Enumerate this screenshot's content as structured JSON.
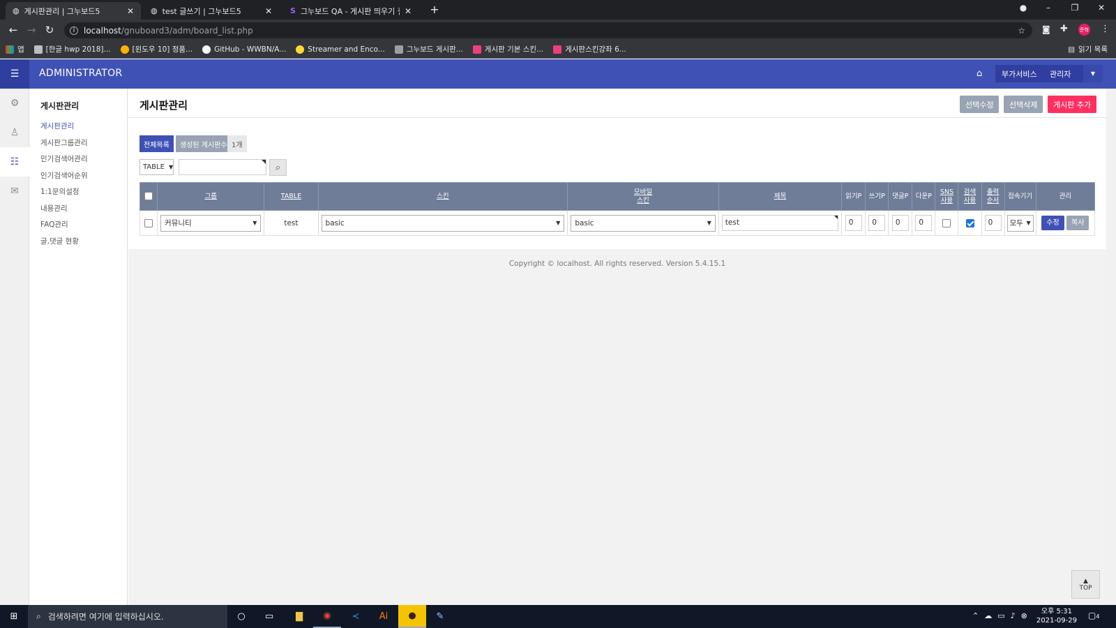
{
  "browser": {
    "tabs": [
      {
        "label": "게시판관리 | 그누보드5",
        "active": true
      },
      {
        "label": "test 글쓰기 | 그누보드5",
        "active": false
      },
      {
        "label": "그누보드 QA - 게시판 띄우기 질",
        "active": false
      }
    ],
    "url_host": "localhost",
    "url_path": "/gnuboard3/adm/board_list.php",
    "profile_label": "준혁",
    "reading_list": "읽기 목록",
    "bookmarks": [
      {
        "label": "앱",
        "color": "#e53935"
      },
      {
        "label": "[한글 hwp 2018]...",
        "color": "#bdbdbd"
      },
      {
        "label": "[윈도우 10] 정품...",
        "color": "#ffb300"
      },
      {
        "label": "GitHub - WWBN/A...",
        "color": "#ffffff"
      },
      {
        "label": "Streamer and Enco...",
        "color": "#fdd835"
      },
      {
        "label": "그누보드 게시판...",
        "color": "#9e9e9e"
      },
      {
        "label": "게시판 기본 스킨...",
        "color": "#ec407a"
      },
      {
        "label": "게시판스킨강좌 6...",
        "color": "#ec407a"
      }
    ]
  },
  "admin": {
    "brand": "ADMINISTRATOR",
    "header_buttons": {
      "addon": "부가서비스",
      "admin": "관리자"
    },
    "subnav_title": "게시판관리",
    "subnav_items": [
      "게시판관리",
      "게시판그룹관리",
      "인기검색어관리",
      "인기검색어순위",
      "1:1문의설정",
      "내용관리",
      "FAQ관리",
      "글,댓글 현황"
    ],
    "page_title": "게시판관리",
    "actions": {
      "edit_selected": "선택수정",
      "delete_selected": "선택삭제",
      "add_board": "게시판 추가"
    },
    "summary": {
      "all_list": "전체목록",
      "created_boards": "생성된 게시판수",
      "count": "1개"
    },
    "search": {
      "field": "TABLE",
      "value": ""
    },
    "table": {
      "headers": [
        "그룹",
        "TABLE",
        "스킨",
        "모바일\n스킨",
        "제목",
        "읽기P",
        "쓰기P",
        "댓글P",
        "다운P",
        "SNS\n사용",
        "검색\n사용",
        "출력\n순서",
        "접속기기",
        "관리"
      ],
      "rows": [
        {
          "group": "커뮤니티",
          "table": "test",
          "skin": "basic",
          "mobile_skin": "basic",
          "subject": "test",
          "read_point": "0",
          "write_point": "0",
          "comment_point": "0",
          "download_point": "0",
          "sns_use": false,
          "search_use": true,
          "order": "0",
          "device": "모두",
          "edit": "수정",
          "copy": "복사"
        }
      ]
    },
    "copyright": "Copyright © localhost. All rights reserved. Version 5.4.15.1",
    "top_button": "TOP"
  },
  "taskbar": {
    "search_placeholder": "검색하려면 여기에 입력하십시오.",
    "time": "오후 5:31",
    "date": "2021-09-29",
    "notif_count": "4"
  },
  "colors": {
    "primary": "#3f51b5",
    "primary_dark": "#303f9f",
    "danger": "#ff3061",
    "gray_btn": "#98a3b3",
    "table_header": "#6f7d98"
  }
}
